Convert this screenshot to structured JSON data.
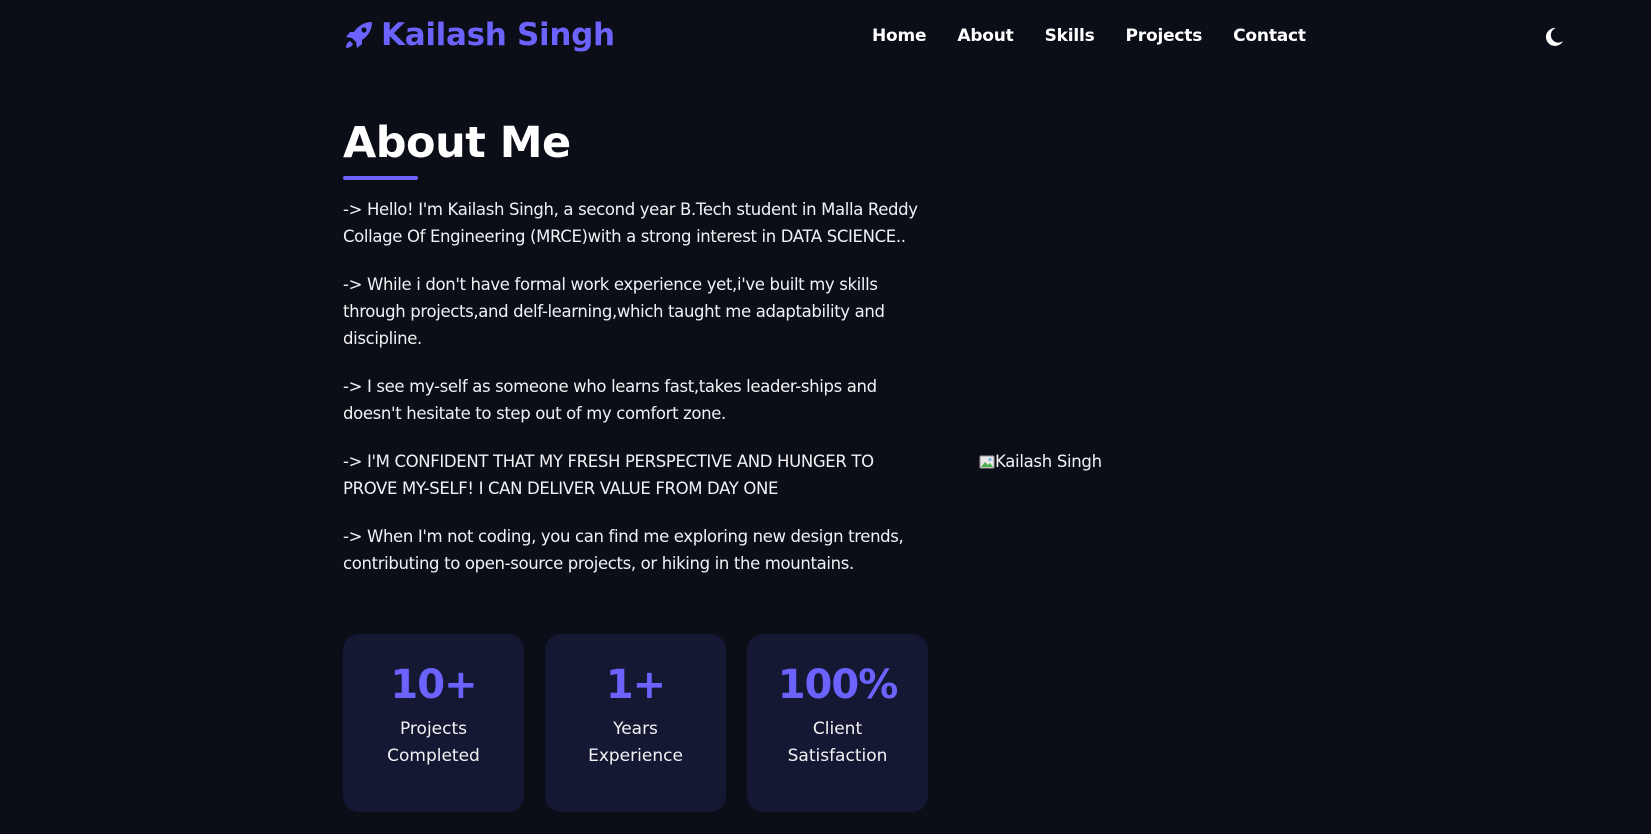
{
  "navbar": {
    "brand_name": "Kailash Singh",
    "brand_icon": "rocket-icon",
    "links": [
      "Home",
      "About",
      "Skills",
      "Projects",
      "Contact"
    ],
    "theme_icon": "moon-icon"
  },
  "about": {
    "title": "About Me",
    "paragraphs": [
      "-> Hello! I'm Kailash Singh, a second year B.Tech student in Malla Reddy Collage Of Engineering (MRCE)with a strong interest in DATA SCIENCE..",
      "-> While i don't have formal work experience yet,i've built my skills through projects,and delf-learning,which taught me adaptability and discipline.",
      "-> I see my-self as someone who learns fast,takes leader-ships and doesn't hesitate to step out of my comfort zone.",
      "-> I'M CONFIDENT THAT MY FRESH PERSPECTIVE AND HUNGER TO PROVE MY-SELF! I CAN DELIVER VALUE FROM DAY ONE",
      "-> When I'm not coding, you can find me exploring new design trends, contributing to open-source projects, or hiking in the mountains."
    ],
    "stats": [
      {
        "value": "10+",
        "label": "Projects Completed"
      },
      {
        "value": "1+",
        "label": "Years Experience"
      },
      {
        "value": "100%",
        "label": "Client Satisfaction"
      }
    ],
    "profile_image_alt": "Kailash Singh"
  },
  "colors": {
    "background": "#0b0e17",
    "accent": "#6c63ff",
    "card": "#151833",
    "text": "#ffffff"
  }
}
